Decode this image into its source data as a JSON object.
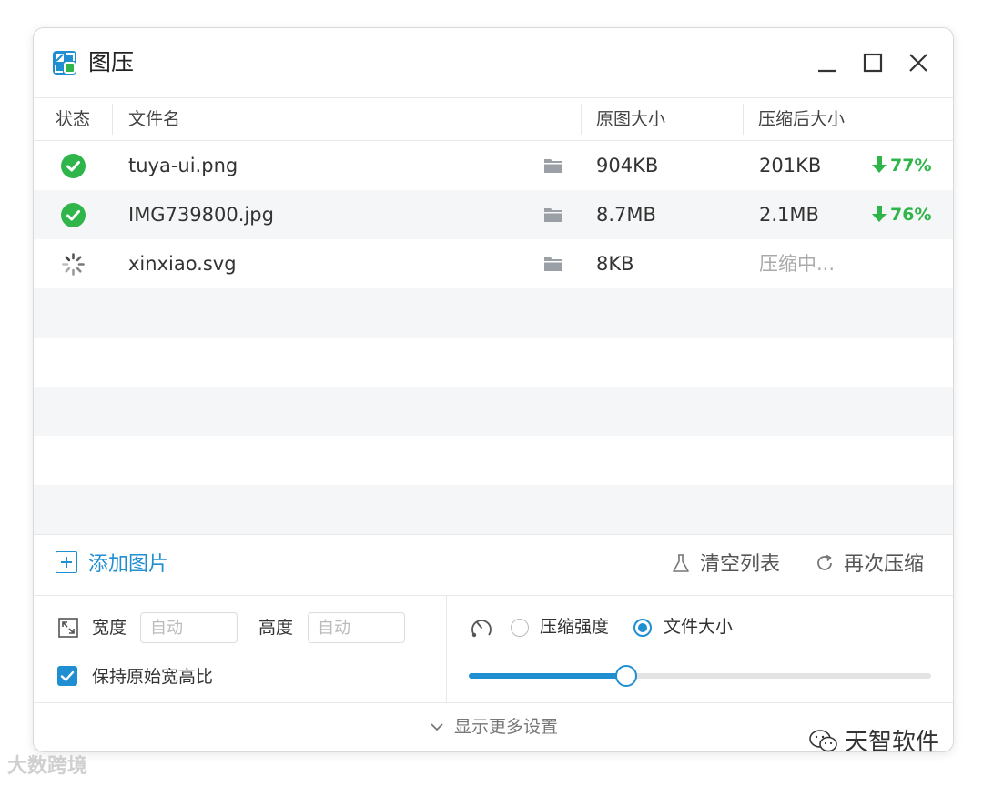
{
  "window": {
    "title": "图压",
    "controls": [
      "minimize-icon",
      "maximize-icon",
      "close-icon"
    ]
  },
  "table": {
    "headers": {
      "status": "状态",
      "filename": "文件名",
      "original_size": "原图大小",
      "compressed_size": "压缩后大小"
    },
    "rows": [
      {
        "status": "done",
        "icon": "check-circle-icon",
        "filename": "tuya-ui.png",
        "original_size": "904KB",
        "compressed_size": "201KB",
        "reduction": "77%"
      },
      {
        "status": "done",
        "icon": "check-circle-icon",
        "filename": "IMG739800.jpg",
        "original_size": "8.7MB",
        "compressed_size": "2.1MB",
        "reduction": "76%"
      },
      {
        "status": "processing",
        "icon": "spinner-icon",
        "filename": "xinxiao.svg",
        "original_size": "8KB",
        "compressed_size": "压缩中..."
      }
    ]
  },
  "actions": {
    "add_images": "添加图片",
    "clear_list": "清空列表",
    "recompress": "再次压缩"
  },
  "settings": {
    "width_label": "宽度",
    "width_placeholder": "自动",
    "height_label": "高度",
    "height_placeholder": "自动",
    "keep_ratio_label": "保持原始宽高比",
    "keep_ratio_checked": true,
    "mode_options": [
      "压缩强度",
      "文件大小"
    ],
    "mode_selected": "文件大小",
    "slider_value": 0.34
  },
  "footer": {
    "more_settings": "显示更多设置"
  },
  "colors": {
    "accent": "#1f8fd1",
    "success": "#2fb54a"
  },
  "watermarks": {
    "left": "大数跨境",
    "right": "天智软件"
  }
}
